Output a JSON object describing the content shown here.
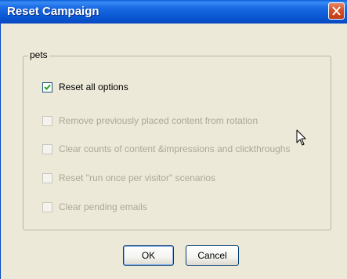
{
  "window": {
    "title": "Reset Campaign"
  },
  "group": {
    "label": "pets"
  },
  "options": [
    {
      "label": "Reset all options",
      "checked": true,
      "enabled": true
    },
    {
      "label": "Remove previously placed content from rotation",
      "checked": false,
      "enabled": false
    },
    {
      "label": "Clear counts of content &impressions and clickthroughs",
      "checked": false,
      "enabled": false
    },
    {
      "label": "Reset \"run once per visitor\" scenarios",
      "checked": false,
      "enabled": false
    },
    {
      "label": "Clear pending emails",
      "checked": false,
      "enabled": false
    }
  ],
  "buttons": {
    "ok": "OK",
    "cancel": "Cancel"
  },
  "icons": {
    "close": "close-icon",
    "check": "checkmark-icon",
    "cursor": "mouse-pointer-icon"
  },
  "colors": {
    "titlebar": "#0a58d4",
    "close_button": "#c13a14",
    "dialog_background": "#ece9d8",
    "disabled_text": "#aca899"
  }
}
